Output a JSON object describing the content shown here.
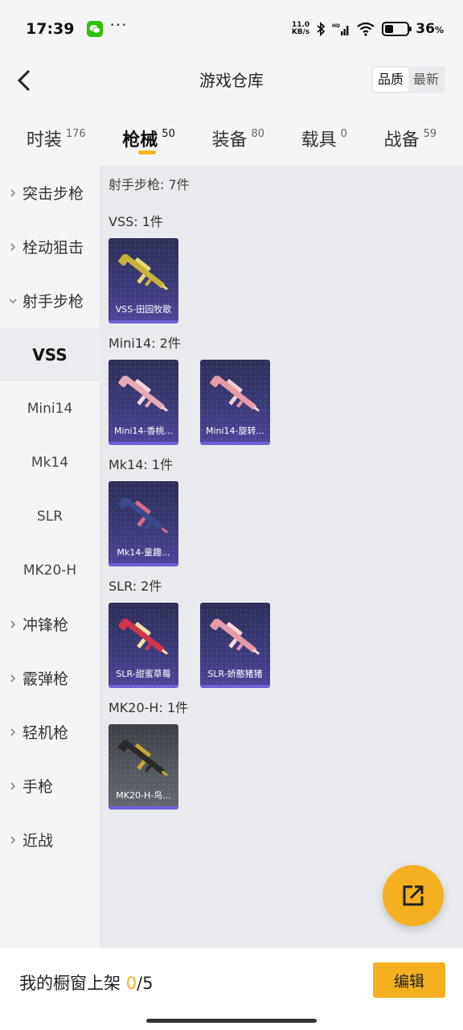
{
  "status_bar": {
    "time": "17:39",
    "net_speed_value": "11.0",
    "net_speed_unit": "KB/s",
    "battery_level": "36",
    "battery_unit": "%"
  },
  "header": {
    "title": "游戏仓库",
    "sort_options": [
      "品质",
      "最新"
    ],
    "sort_active": "品质"
  },
  "tabs": [
    {
      "label": "时装",
      "count": "176"
    },
    {
      "label": "枪械",
      "count": "50",
      "active": true
    },
    {
      "label": "装备",
      "count": "80"
    },
    {
      "label": "载具",
      "count": "0"
    },
    {
      "label": "战备",
      "count": "59"
    }
  ],
  "sidebar": {
    "items": [
      {
        "label": "突击步枪",
        "type": "category"
      },
      {
        "label": "栓动狙击",
        "type": "category"
      },
      {
        "label": "射手步枪",
        "type": "category",
        "expanded": true
      },
      {
        "label": "VSS",
        "type": "sub",
        "active": true
      },
      {
        "label": "Mini14",
        "type": "sub"
      },
      {
        "label": "Mk14",
        "type": "sub"
      },
      {
        "label": "SLR",
        "type": "sub"
      },
      {
        "label": "MK20-H",
        "type": "sub"
      },
      {
        "label": "冲锋枪",
        "type": "category"
      },
      {
        "label": "霰弹枪",
        "type": "category"
      },
      {
        "label": "轻机枪",
        "type": "category"
      },
      {
        "label": "手枪",
        "type": "category"
      },
      {
        "label": "近战",
        "type": "category"
      }
    ]
  },
  "content": {
    "summary": "射手步枪: 7件",
    "groups": [
      {
        "title": "VSS: 1件",
        "skins": [
          {
            "name": "VSS-田园牧歌",
            "colors": [
              "#c9b23a",
              "#e6d870"
            ]
          }
        ]
      },
      {
        "title": "Mini14: 2件",
        "skins": [
          {
            "name": "Mini14-香桃...",
            "colors": [
              "#e8a8b4",
              "#f6d4dc"
            ]
          },
          {
            "name": "Mini14-旋转...",
            "colors": [
              "#e89aa6",
              "#f3cdd4"
            ]
          }
        ]
      },
      {
        "title": "Mk14: 1件",
        "skins": [
          {
            "name": "Mk14-童趣...",
            "colors": [
              "#3a4a8c",
              "#d86a8a"
            ]
          }
        ]
      },
      {
        "title": "SLR: 2件",
        "skins": [
          {
            "name": "SLR-甜蜜草莓",
            "colors": [
              "#d4344a",
              "#f1e3a8"
            ]
          },
          {
            "name": "SLR-娇憨猪猪",
            "colors": [
              "#e79aa8",
              "#f7d6dc"
            ]
          }
        ]
      },
      {
        "title": "MK20-H: 1件",
        "skins": [
          {
            "name": "MK20-H-鸟...",
            "colors": [
              "#2a2a2a",
              "#c9a632"
            ]
          }
        ]
      }
    ]
  },
  "bottom_bar": {
    "showcase_label": "我的橱窗上架",
    "showcase_current": "0",
    "showcase_total": "/5",
    "edit_label": "编辑"
  },
  "colors": {
    "accent": "#f5b020",
    "card_purple": "#3a3a78",
    "card_grey": "#53575f"
  },
  "icons": [
    "wechat-icon",
    "bluetooth-icon",
    "signal-icon",
    "wifi-icon",
    "battery-icon",
    "back-arrow-icon",
    "chevron-right-icon",
    "chevron-down-icon",
    "share-external-icon"
  ]
}
